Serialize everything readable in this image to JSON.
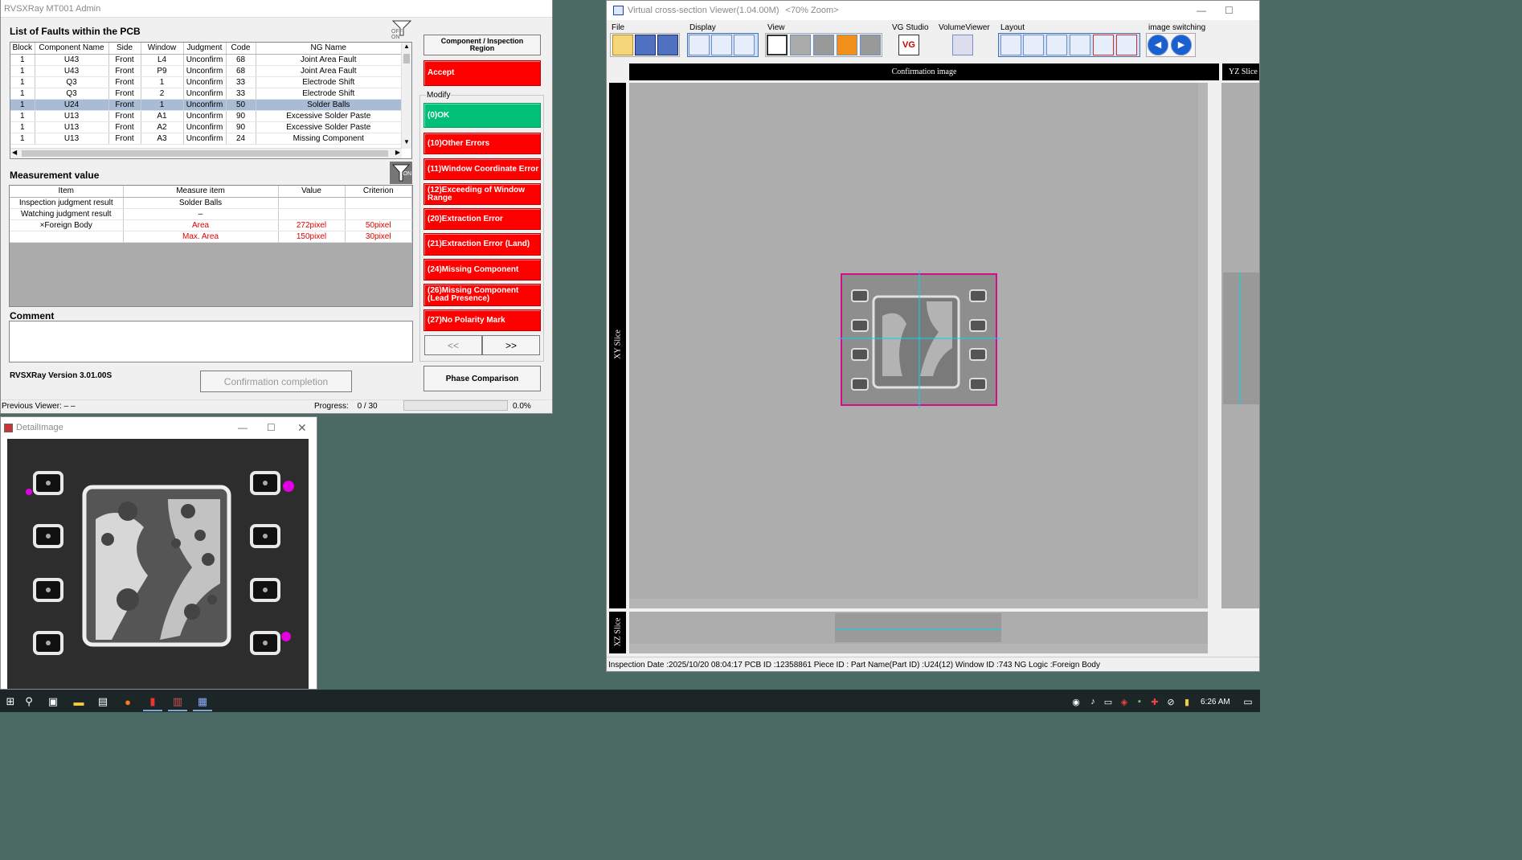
{
  "rvs": {
    "title": "RVSXRay MT001 Admin",
    "faults_title": "List of Faults within the PCB",
    "filter_off": "OFF ON",
    "columns": [
      "Block",
      "Component Name",
      "Side",
      "Window",
      "Judgment",
      "Code",
      "NG Name"
    ],
    "rows": [
      [
        "1",
        "U43",
        "Front",
        "L4",
        "Unconfirm",
        "68",
        "Joint Area Fault"
      ],
      [
        "1",
        "U43",
        "Front",
        "P9",
        "Unconfirm",
        "68",
        "Joint Area Fault"
      ],
      [
        "1",
        "Q3",
        "Front",
        "1",
        "Unconfirm",
        "33",
        "Electrode Shift"
      ],
      [
        "1",
        "Q3",
        "Front",
        "2",
        "Unconfirm",
        "33",
        "Electrode Shift"
      ],
      [
        "1",
        "U24",
        "Front",
        "1",
        "Unconfirm",
        "50",
        "Solder Balls"
      ],
      [
        "1",
        "U13",
        "Front",
        "A1",
        "Unconfirm",
        "90",
        "Excessive Solder Paste"
      ],
      [
        "1",
        "U13",
        "Front",
        "A2",
        "Unconfirm",
        "90",
        "Excessive Solder Paste"
      ],
      [
        "1",
        "U13",
        "Front",
        "A3",
        "Unconfirm",
        "24",
        "Missing Component"
      ]
    ],
    "measure_title": "Measurement value",
    "filter_on": "ON",
    "measure_columns": [
      "Item",
      "Measure item",
      "Value",
      "Criterion"
    ],
    "measure_rows": [
      {
        "item": "Inspection judgment result",
        "measure": "Solder Balls",
        "value": "",
        "criterion": "",
        "red": false
      },
      {
        "item": "Watching judgment result",
        "measure": "–",
        "value": "",
        "criterion": "",
        "red": false
      },
      {
        "item": "×Foreign Body",
        "measure": "Area",
        "value": "272pixel",
        "criterion": "50pixel",
        "red": true
      },
      {
        "item": "",
        "measure": "Max. Area",
        "value": "150pixel",
        "criterion": "30pixel",
        "red": true
      }
    ],
    "comment_label": "Comment",
    "version": "RVSXRay Version 3.01.00S",
    "confirm_btn": "Confirmation completion",
    "prev_viewer_label": "Previous Viewer:",
    "prev_viewer_value": "– –",
    "progress_label": "Progress:",
    "progress_value": "0 / 30",
    "progress_pct": "0.0%",
    "progress_fraction": 0,
    "comp_btn": "Component / Inspection Region",
    "accept_btn": "Accept",
    "modify_label": "Modify",
    "ok_btn": "(0)OK",
    "errors": [
      "(10)Other Errors",
      "(11)Window Coordinate Error",
      "(12)Exceeding of Window Range",
      "(20)Extraction Error",
      "(21)Extraction Error (Land)",
      "(24)Missing Component",
      "(26)Missing Component (Lead Presence)",
      "(27)No Polarity Mark"
    ],
    "prev_btn": "<<",
    "next_btn": ">>",
    "phase_btn": "Phase Comparison"
  },
  "detail": {
    "title": "DetailImage"
  },
  "vcs": {
    "title": "Virtual cross-section Viewer(1.04.00M)",
    "zoom": "<70% Zoom>",
    "groups": [
      "File",
      "Display",
      "View",
      "VG Studio",
      "VolumeViewer",
      "Layout",
      "image switching"
    ],
    "confirm_header": "Confirmation image",
    "yz_label": "YZ Slice",
    "xy_label": "XY Slice",
    "xz_label": "XZ Slice",
    "status": "Inspection Date :2025/10/20 08:04:17  PCB ID :12358861  Piece ID :  Part Name(Part ID) :U24(12)  Window ID :743  NG Logic :Foreign Body"
  },
  "taskbar": {
    "time": "6:26 AM"
  },
  "colors": {
    "accent_red": "#ff0000",
    "ok_green": "#00c078",
    "desktop": "#4a6a63",
    "magenta": "#e000e0",
    "cyan": "#00e0e0"
  }
}
